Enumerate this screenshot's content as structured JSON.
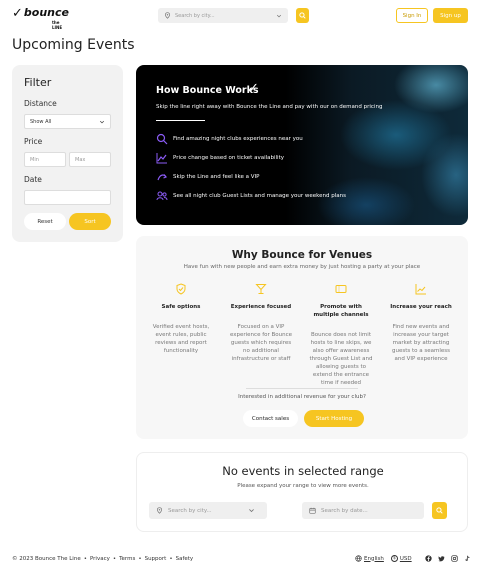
{
  "brand": {
    "check": "✓",
    "name": "bounce",
    "tagline": "the LINE"
  },
  "header": {
    "search_placeholder": "Search by city...",
    "signin_label": "Sign In",
    "signup_label": "Sign up"
  },
  "page_title": "Upcoming Events",
  "filter": {
    "title": "Filter",
    "distance_label": "Distance",
    "distance_value": "Show All",
    "price_label": "Price",
    "min_placeholder": "Min",
    "max_placeholder": "Max",
    "date_label": "Date",
    "reset_label": "Reset",
    "sort_label": "Sort"
  },
  "hero": {
    "title": "How Bounce Works",
    "check": "✓",
    "subtitle": "Skip the line right away with Bounce the Line and pay with our on demand pricing",
    "items": [
      {
        "icon": "search-icon",
        "text": "Find amazing night clubs experiences near you"
      },
      {
        "icon": "chart-icon",
        "text": "Price change based on ticket availability"
      },
      {
        "icon": "arrow-icon",
        "text": "Skip the Line and feel like a VIP"
      },
      {
        "icon": "users-icon",
        "text": "See all night club Guest Lists and manage your weekend plans"
      }
    ],
    "accent_color": "#8b5cf6"
  },
  "venues": {
    "title": "Why Bounce for Venues",
    "subtitle": "Have fun with new people and earn extra money by just hosting a party at your place",
    "columns": [
      {
        "icon": "shield-icon",
        "title": "Safe options",
        "desc": "Verified event hosts, event rules, public reviews and report functionality"
      },
      {
        "icon": "cocktail-icon",
        "title": "Experience focused",
        "desc": "Focused on a VIP experience for Bounce guests which requires no additional infrastructure or staff"
      },
      {
        "icon": "ticket-icon",
        "title": "Promote with multiple channels",
        "desc": "Bounce does not limit hosts to line skips, we also offer awareness through Guest List and allowing guests to extend the entrance time if needed"
      },
      {
        "icon": "chart-up-icon",
        "title": "Increase your reach",
        "desc": "Find new events and increase your target market by attracting guests to a seamless and VIP experience"
      }
    ],
    "interest_text": "Interested in additional revenue for your club?",
    "contact_label": "Contact sales",
    "hosting_label": "Start Hosting"
  },
  "empty": {
    "title": "No events in selected range",
    "subtitle": "Please expand your range to view more events.",
    "city_placeholder": "Search by city...",
    "date_placeholder": "Search by date..."
  },
  "footer": {
    "copyright": "© 2023 Bounce The Line",
    "links": [
      "Privacy",
      "Terms",
      "Support",
      "Safety"
    ],
    "sep": "•",
    "language": "English",
    "currency_symbol": "$",
    "currency": "USD"
  },
  "colors": {
    "accent": "#f6c521",
    "hero_bg": "#000000"
  }
}
